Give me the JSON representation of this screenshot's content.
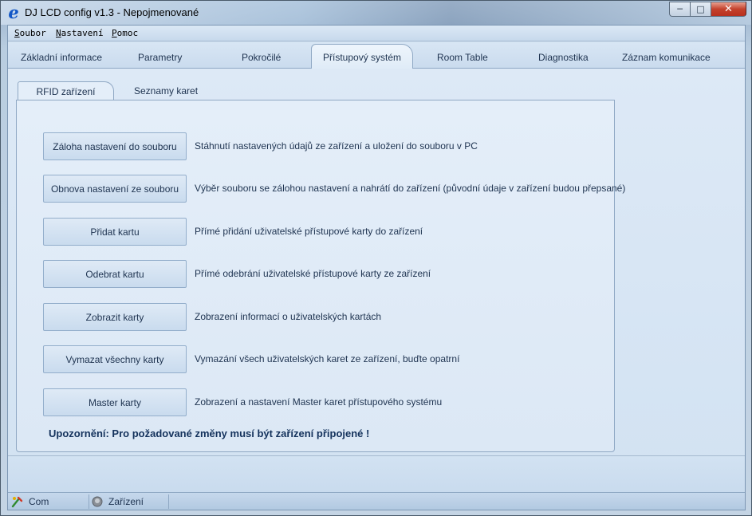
{
  "window": {
    "title": "DJ LCD config v1.3 - Nepojmenované",
    "app_icon": "e",
    "controls": {
      "minimize": "─",
      "maximize": "□",
      "close": "✕"
    }
  },
  "menu": [
    {
      "label": "Soubor",
      "mnemonic": "S",
      "rest": "oubor"
    },
    {
      "label": "Nastavení",
      "mnemonic": "N",
      "rest": "astavení"
    },
    {
      "label": "Pomoc",
      "mnemonic": "P",
      "rest": "omoc"
    }
  ],
  "tabs": [
    "Základní informace",
    "Parametry",
    "Pokročilé",
    "Přístupový systém",
    "Room Table",
    "Diagnostika",
    "Záznam komunikace"
  ],
  "active_tab": "Přístupový systém",
  "sub_tabs": [
    "RFID zařízení",
    "Seznamy karet"
  ],
  "active_sub_tab": "RFID zařízení",
  "actions": [
    {
      "label": "Záloha nastavení do souboru",
      "desc": "Stáhnutí nastavených údajů ze zařízení a uložení do souboru v PC"
    },
    {
      "label": "Obnova nastavení ze souboru",
      "desc": "Výběr souboru se zálohou nastavení a nahrátí do zařízení (původní údaje v zařízení budou přepsané)"
    },
    {
      "label": "Přidat kartu",
      "desc": "Přímé přidání uživatelské přístupové karty do zařízení"
    },
    {
      "label": "Odebrat kartu",
      "desc": "Přímé odebrání uživatelské přístupové karty ze zařízení"
    },
    {
      "label": "Zobrazit karty",
      "desc": "Zobrazení informací o uživatelských kartách"
    },
    {
      "label": "Vymazat všechny karty",
      "desc": "Vymazání všech uživatelských karet ze zařízení, buďte opatrní"
    },
    {
      "label": "Master karty",
      "desc": "Zobrazení a nastavení Master karet přístupového systému"
    }
  ],
  "warning": "Upozornění: Pro požadované změny musí být zařízení připojené !",
  "status": {
    "com_label": "Com",
    "device_label": "Zařízení"
  },
  "colors": {
    "accent": "#1256c6",
    "warning_text": "#14325c",
    "close_button": "#c4412c"
  }
}
